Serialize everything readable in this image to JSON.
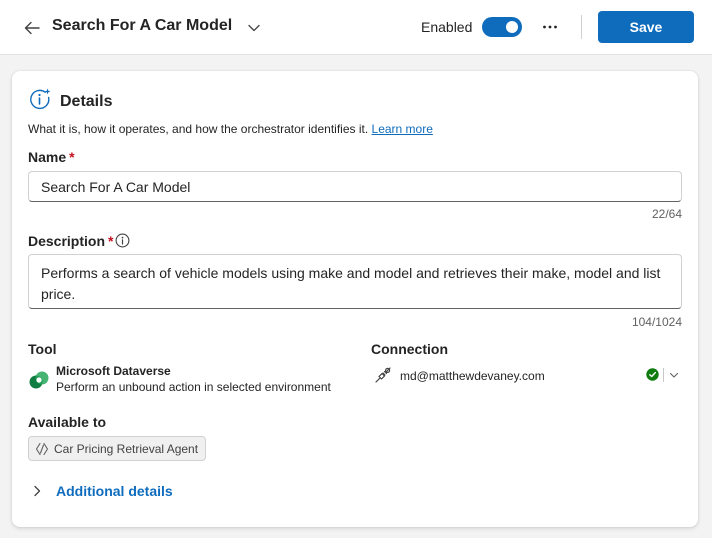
{
  "header": {
    "title": "Search For A Car Model",
    "enabled_label": "Enabled",
    "enabled": true,
    "save_label": "Save",
    "icons": [
      "arrow-left-icon",
      "chevron-down-icon",
      "more-horizontal-icon"
    ]
  },
  "colors": {
    "accent": "#0f6cbd",
    "required": "#c50f1f",
    "status_ok": "#107c10",
    "page_bg": "#f3f3f3"
  },
  "details": {
    "title": "Details",
    "icon": "info-sparkle-icon",
    "description": "What it is, how it operates, and how the orchestrator identifies it.",
    "learn_more": "Learn more"
  },
  "name_field": {
    "label": "Name",
    "required_mark": "*",
    "value": "Search For A Car Model",
    "counter": "22/64"
  },
  "description_field": {
    "label": "Description",
    "required_mark": "*",
    "value": "Performs a search of vehicle models using make and model and retrieves their make, model and list price.",
    "counter": "104/1024",
    "info_icon": "info-icon"
  },
  "tool": {
    "label": "Tool",
    "name": "Microsoft Dataverse",
    "description": "Perform an unbound action in selected environment",
    "icon": "dataverse-logo-icon"
  },
  "connection": {
    "label": "Connection",
    "email": "md@matthewdevaney.com",
    "icon": "plug-icon",
    "status": "connected",
    "status_icon": "checkmark-circle-icon"
  },
  "available_to": {
    "label": "Available to",
    "agent": "Car Pricing Retrieval Agent",
    "icon": "agent-icon"
  },
  "additional_details": {
    "label": "Additional details",
    "icon": "chevron-right-icon"
  }
}
